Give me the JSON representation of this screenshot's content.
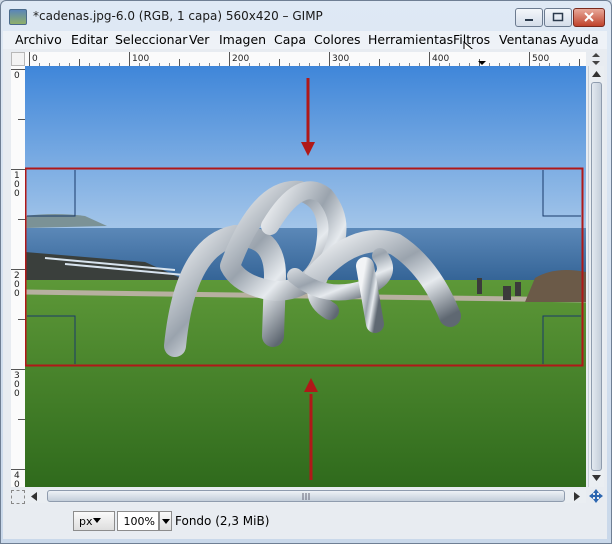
{
  "window": {
    "title": "*cadenas.jpg-6.0 (RGB, 1 capa) 560x420 – GIMP",
    "controls": [
      "minimize-icon",
      "maximize-icon",
      "close-icon"
    ]
  },
  "menubar": {
    "items": [
      {
        "label": "Archivo"
      },
      {
        "label": "Editar"
      },
      {
        "label": "Seleccionar"
      },
      {
        "label": "Ver"
      },
      {
        "label": "Imagen"
      },
      {
        "label": "Capa"
      },
      {
        "label": "Colores"
      },
      {
        "label": "Herramientas"
      },
      {
        "label": "Filtros"
      },
      {
        "label": "Ventanas"
      },
      {
        "label": "Ayuda"
      }
    ]
  },
  "rulers": {
    "horizontal_labels": [
      "0",
      "100",
      "200",
      "300",
      "400",
      "500"
    ],
    "vertical_labels": [
      "0",
      "100",
      "200",
      "300",
      "400"
    ]
  },
  "canvas": {
    "image_name": "cadenas.jpg",
    "selection_color": "#b01818",
    "arrow_color": "#b01818",
    "guide_color": "#1a3a6a"
  },
  "statusbar": {
    "unit": "px",
    "zoom": "100%",
    "layer_info": "Fondo (2,3 MiB)"
  },
  "icons": {
    "quick_mask": "quick-mask-icon",
    "navigate": "navigate-icon",
    "pointer": "mouse-pointer-icon"
  }
}
